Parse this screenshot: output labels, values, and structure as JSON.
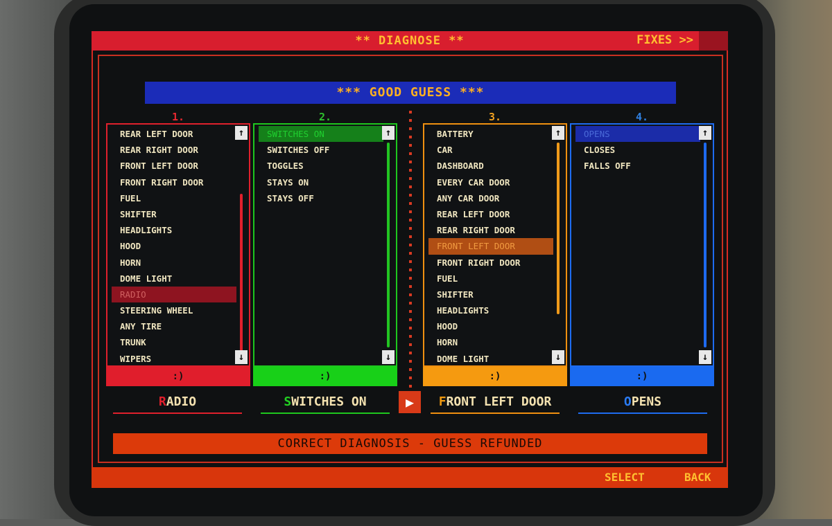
{
  "header": {
    "title": "** DIAGNOSE **",
    "fixes_label": "FIXES >>"
  },
  "banner": "*** GOOD GUESS ***",
  "columns": [
    {
      "number": "1.",
      "items": [
        "REAR LEFT DOOR",
        "REAR RIGHT DOOR",
        "FRONT LEFT DOOR",
        "FRONT RIGHT DOOR",
        "FUEL",
        "SHIFTER",
        "HEADLIGHTS",
        "HOOD",
        "HORN",
        "DOME LIGHT",
        "RADIO",
        "STEERING WHEEL",
        "ANY TIRE",
        "TRUNK",
        "WIPERS"
      ],
      "selected": "RADIO",
      "footer": ":)"
    },
    {
      "number": "2.",
      "items": [
        "SWITCHES ON",
        "SWITCHES OFF",
        "TOGGLES",
        "STAYS ON",
        "STAYS OFF"
      ],
      "selected": "SWITCHES ON",
      "footer": ":)"
    },
    {
      "number": "3.",
      "items": [
        "BATTERY",
        "CAR",
        "DASHBOARD",
        "EVERY CAR DOOR",
        "ANY CAR DOOR",
        "REAR LEFT DOOR",
        "REAR RIGHT DOOR",
        "FRONT LEFT DOOR",
        "FRONT RIGHT DOOR",
        "FUEL",
        "SHIFTER",
        "HEADLIGHTS",
        "HOOD",
        "HORN",
        "DOME LIGHT"
      ],
      "selected": "FRONT LEFT DOOR",
      "footer": ":)"
    },
    {
      "number": "4.",
      "items": [
        "OPENS",
        "CLOSES",
        "FALLS OFF"
      ],
      "selected": "OPENS",
      "footer": ":)"
    }
  ],
  "answers": [
    {
      "first": "R",
      "rest": "ADIO"
    },
    {
      "first": "S",
      "rest": "WITCHES ON"
    },
    {
      "first": "F",
      "rest": "RONT LEFT DOOR"
    },
    {
      "first": "O",
      "rest": "PENS"
    }
  ],
  "play_icon": "play-icon",
  "status": "CORRECT DIAGNOSIS - GUESS REFUNDED",
  "footer": {
    "select_label": "SELECT",
    "back_label": "BACK"
  },
  "colors": {
    "red": "#e0202c",
    "green": "#1ec81e",
    "orange": "#f09010",
    "blue": "#1e6cf0",
    "text": "#ffc030"
  }
}
